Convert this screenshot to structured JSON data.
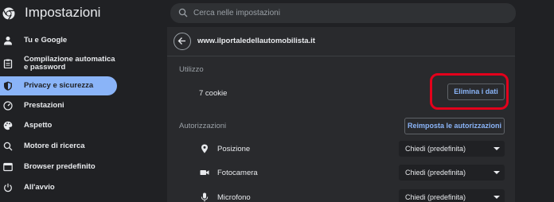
{
  "header": {
    "title": "Impostazioni",
    "search_placeholder": "Cerca nelle impostazioni"
  },
  "sidebar": {
    "items": [
      {
        "label": "Tu e Google",
        "icon": "person-icon"
      },
      {
        "label": "Compilazione automatica e password",
        "icon": "clipboard-icon"
      },
      {
        "label": "Privacy e sicurezza",
        "icon": "shield-icon",
        "active": true
      },
      {
        "label": "Prestazioni",
        "icon": "speedometer-icon"
      },
      {
        "label": "Aspetto",
        "icon": "palette-icon"
      },
      {
        "label": "Motore di ricerca",
        "icon": "search-icon"
      },
      {
        "label": "Browser predefinito",
        "icon": "browser-icon"
      },
      {
        "label": "All'avvio",
        "icon": "power-icon"
      }
    ]
  },
  "main": {
    "site": "www.ilportaledellautomobilista.it",
    "usage_label": "Utilizzo",
    "cookies": "7 cookie",
    "clear_button": "Elimina i dati",
    "permissions_label": "Autorizzazioni",
    "reset_button": "Reimposta le autorizzazioni",
    "permissions": [
      {
        "label": "Posizione",
        "value": "Chiedi (predefinita)",
        "icon": "location-pin-icon"
      },
      {
        "label": "Fotocamera",
        "value": "Chiedi (predefinita)",
        "icon": "camera-icon"
      },
      {
        "label": "Microfono",
        "value": "Chiedi (predefinita)",
        "icon": "microphone-icon"
      }
    ]
  },
  "colors": {
    "accent": "#8ab4f8",
    "highlight": "#e3001b",
    "background": "#202124",
    "surface": "#292a2d"
  }
}
